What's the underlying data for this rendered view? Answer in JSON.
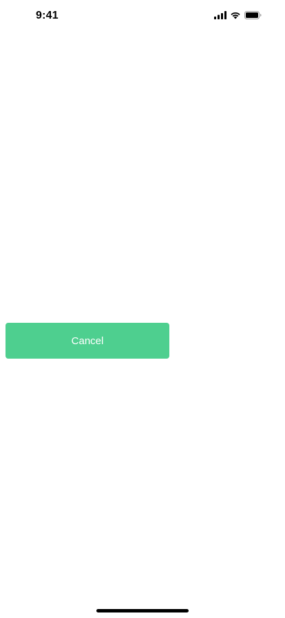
{
  "status_bar": {
    "time": "9:41",
    "icons": [
      "cellular-signal-icon",
      "wifi-icon",
      "battery-icon"
    ]
  },
  "main": {
    "cancel_label": "Cancel"
  },
  "colors": {
    "accent": "#4ecf8f",
    "button_text": "#ffffff",
    "background": "#ffffff"
  }
}
